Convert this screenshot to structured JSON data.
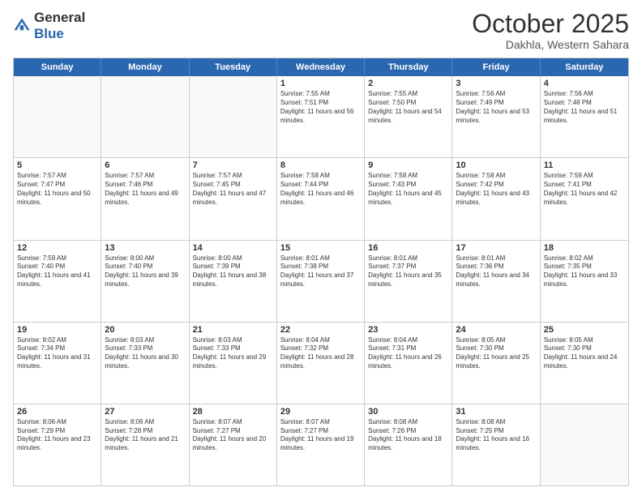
{
  "header": {
    "logo_general": "General",
    "logo_blue": "Blue",
    "month": "October 2025",
    "location": "Dakhla, Western Sahara"
  },
  "days_of_week": [
    "Sunday",
    "Monday",
    "Tuesday",
    "Wednesday",
    "Thursday",
    "Friday",
    "Saturday"
  ],
  "weeks": [
    [
      {
        "num": "",
        "sunrise": "",
        "sunset": "",
        "daylight": ""
      },
      {
        "num": "",
        "sunrise": "",
        "sunset": "",
        "daylight": ""
      },
      {
        "num": "",
        "sunrise": "",
        "sunset": "",
        "daylight": ""
      },
      {
        "num": "1",
        "sunrise": "Sunrise: 7:55 AM",
        "sunset": "Sunset: 7:51 PM",
        "daylight": "Daylight: 11 hours and 56 minutes."
      },
      {
        "num": "2",
        "sunrise": "Sunrise: 7:55 AM",
        "sunset": "Sunset: 7:50 PM",
        "daylight": "Daylight: 11 hours and 54 minutes."
      },
      {
        "num": "3",
        "sunrise": "Sunrise: 7:56 AM",
        "sunset": "Sunset: 7:49 PM",
        "daylight": "Daylight: 11 hours and 53 minutes."
      },
      {
        "num": "4",
        "sunrise": "Sunrise: 7:56 AM",
        "sunset": "Sunset: 7:48 PM",
        "daylight": "Daylight: 11 hours and 51 minutes."
      }
    ],
    [
      {
        "num": "5",
        "sunrise": "Sunrise: 7:57 AM",
        "sunset": "Sunset: 7:47 PM",
        "daylight": "Daylight: 11 hours and 50 minutes."
      },
      {
        "num": "6",
        "sunrise": "Sunrise: 7:57 AM",
        "sunset": "Sunset: 7:46 PM",
        "daylight": "Daylight: 11 hours and 49 minutes."
      },
      {
        "num": "7",
        "sunrise": "Sunrise: 7:57 AM",
        "sunset": "Sunset: 7:45 PM",
        "daylight": "Daylight: 11 hours and 47 minutes."
      },
      {
        "num": "8",
        "sunrise": "Sunrise: 7:58 AM",
        "sunset": "Sunset: 7:44 PM",
        "daylight": "Daylight: 11 hours and 46 minutes."
      },
      {
        "num": "9",
        "sunrise": "Sunrise: 7:58 AM",
        "sunset": "Sunset: 7:43 PM",
        "daylight": "Daylight: 11 hours and 45 minutes."
      },
      {
        "num": "10",
        "sunrise": "Sunrise: 7:58 AM",
        "sunset": "Sunset: 7:42 PM",
        "daylight": "Daylight: 11 hours and 43 minutes."
      },
      {
        "num": "11",
        "sunrise": "Sunrise: 7:59 AM",
        "sunset": "Sunset: 7:41 PM",
        "daylight": "Daylight: 11 hours and 42 minutes."
      }
    ],
    [
      {
        "num": "12",
        "sunrise": "Sunrise: 7:59 AM",
        "sunset": "Sunset: 7:40 PM",
        "daylight": "Daylight: 11 hours and 41 minutes."
      },
      {
        "num": "13",
        "sunrise": "Sunrise: 8:00 AM",
        "sunset": "Sunset: 7:40 PM",
        "daylight": "Daylight: 11 hours and 39 minutes."
      },
      {
        "num": "14",
        "sunrise": "Sunrise: 8:00 AM",
        "sunset": "Sunset: 7:39 PM",
        "daylight": "Daylight: 11 hours and 38 minutes."
      },
      {
        "num": "15",
        "sunrise": "Sunrise: 8:01 AM",
        "sunset": "Sunset: 7:38 PM",
        "daylight": "Daylight: 11 hours and 37 minutes."
      },
      {
        "num": "16",
        "sunrise": "Sunrise: 8:01 AM",
        "sunset": "Sunset: 7:37 PM",
        "daylight": "Daylight: 11 hours and 35 minutes."
      },
      {
        "num": "17",
        "sunrise": "Sunrise: 8:01 AM",
        "sunset": "Sunset: 7:36 PM",
        "daylight": "Daylight: 11 hours and 34 minutes."
      },
      {
        "num": "18",
        "sunrise": "Sunrise: 8:02 AM",
        "sunset": "Sunset: 7:35 PM",
        "daylight": "Daylight: 11 hours and 33 minutes."
      }
    ],
    [
      {
        "num": "19",
        "sunrise": "Sunrise: 8:02 AM",
        "sunset": "Sunset: 7:34 PM",
        "daylight": "Daylight: 11 hours and 31 minutes."
      },
      {
        "num": "20",
        "sunrise": "Sunrise: 8:03 AM",
        "sunset": "Sunset: 7:33 PM",
        "daylight": "Daylight: 11 hours and 30 minutes."
      },
      {
        "num": "21",
        "sunrise": "Sunrise: 8:03 AM",
        "sunset": "Sunset: 7:33 PM",
        "daylight": "Daylight: 11 hours and 29 minutes."
      },
      {
        "num": "22",
        "sunrise": "Sunrise: 8:04 AM",
        "sunset": "Sunset: 7:32 PM",
        "daylight": "Daylight: 11 hours and 28 minutes."
      },
      {
        "num": "23",
        "sunrise": "Sunrise: 8:04 AM",
        "sunset": "Sunset: 7:31 PM",
        "daylight": "Daylight: 11 hours and 26 minutes."
      },
      {
        "num": "24",
        "sunrise": "Sunrise: 8:05 AM",
        "sunset": "Sunset: 7:30 PM",
        "daylight": "Daylight: 11 hours and 25 minutes."
      },
      {
        "num": "25",
        "sunrise": "Sunrise: 8:05 AM",
        "sunset": "Sunset: 7:30 PM",
        "daylight": "Daylight: 11 hours and 24 minutes."
      }
    ],
    [
      {
        "num": "26",
        "sunrise": "Sunrise: 8:06 AM",
        "sunset": "Sunset: 7:29 PM",
        "daylight": "Daylight: 11 hours and 23 minutes."
      },
      {
        "num": "27",
        "sunrise": "Sunrise: 8:06 AM",
        "sunset": "Sunset: 7:28 PM",
        "daylight": "Daylight: 11 hours and 21 minutes."
      },
      {
        "num": "28",
        "sunrise": "Sunrise: 8:07 AM",
        "sunset": "Sunset: 7:27 PM",
        "daylight": "Daylight: 11 hours and 20 minutes."
      },
      {
        "num": "29",
        "sunrise": "Sunrise: 8:07 AM",
        "sunset": "Sunset: 7:27 PM",
        "daylight": "Daylight: 11 hours and 19 minutes."
      },
      {
        "num": "30",
        "sunrise": "Sunrise: 8:08 AM",
        "sunset": "Sunset: 7:26 PM",
        "daylight": "Daylight: 11 hours and 18 minutes."
      },
      {
        "num": "31",
        "sunrise": "Sunrise: 8:08 AM",
        "sunset": "Sunset: 7:25 PM",
        "daylight": "Daylight: 11 hours and 16 minutes."
      },
      {
        "num": "",
        "sunrise": "",
        "sunset": "",
        "daylight": ""
      }
    ]
  ]
}
